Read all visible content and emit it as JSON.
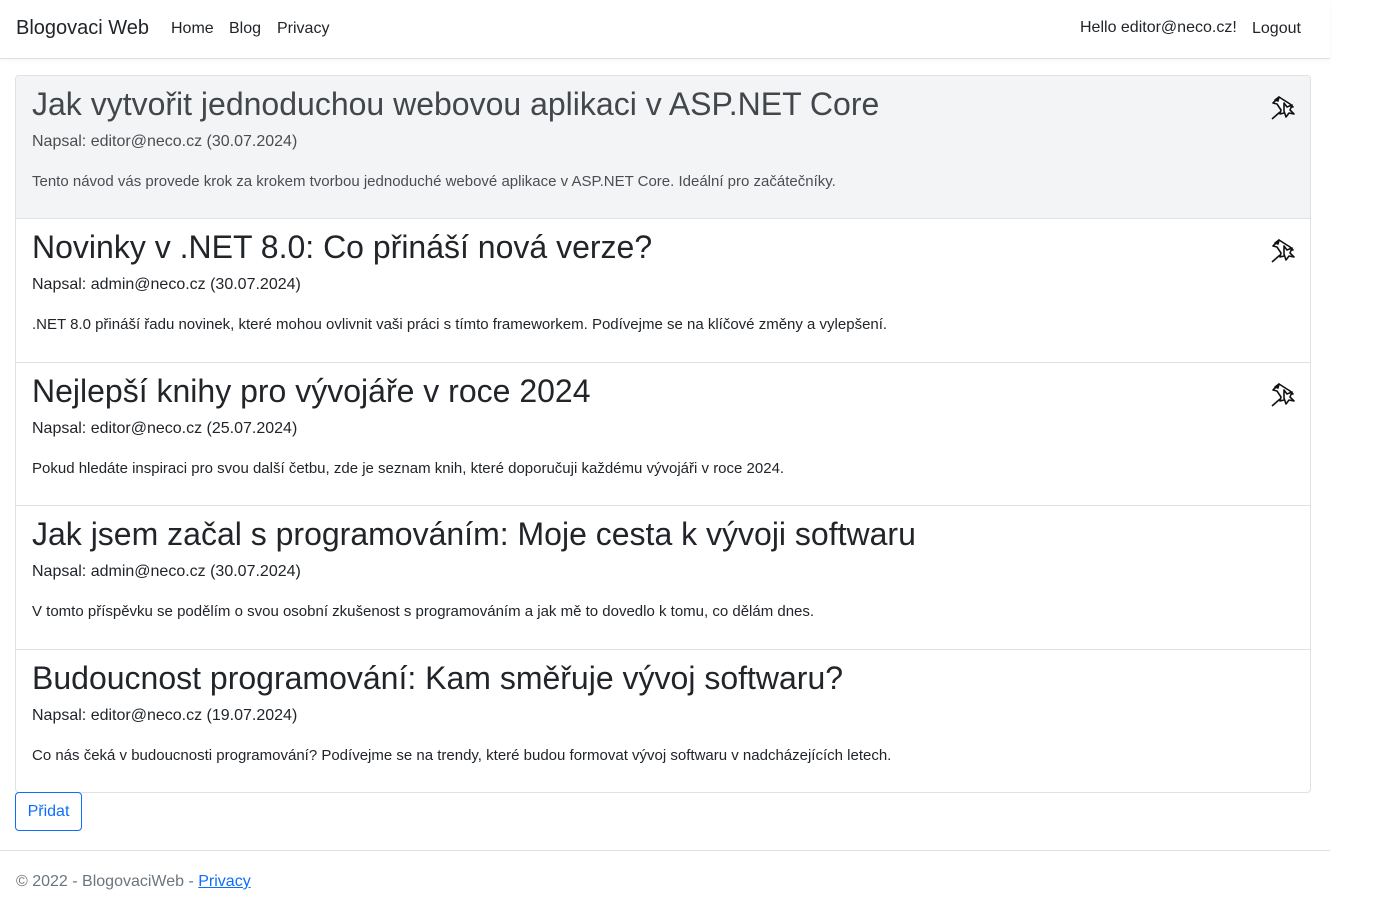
{
  "navbar": {
    "brand": "Blogovaci Web",
    "links": [
      "Home",
      "Blog",
      "Privacy"
    ],
    "greeting": "Hello editor@neco.cz!",
    "logout": "Logout"
  },
  "posts": [
    {
      "title": "Jak vytvořit jednoduchou webovou aplikaci v ASP.NET Core",
      "author": "Napsal: editor@neco.cz (30.07.2024)",
      "text": "Tento návod vás provede krok za krokem tvorbou jednoduché webové aplikace v ASP.NET Core. Ideální pro začátečníky.",
      "pinned": true,
      "active": true
    },
    {
      "title": "Novinky v .NET 8.0: Co přináší nová verze?",
      "author": "Napsal: admin@neco.cz (30.07.2024)",
      "text": ".NET 8.0 přináší řadu novinek, které mohou ovlivnit vaši práci s tímto frameworkem. Podívejme se na klíčové změny a vylepšení.",
      "pinned": true,
      "active": false
    },
    {
      "title": "Nejlepší knihy pro vývojáře v roce 2024",
      "author": "Napsal: editor@neco.cz (25.07.2024)",
      "text": "Pokud hledáte inspiraci pro svou další četbu, zde je seznam knih, které doporučuji každému vývojáři v roce 2024.",
      "pinned": true,
      "active": false
    },
    {
      "title": "Jak jsem začal s programováním: Moje cesta k vývoji softwaru",
      "author": "Napsal: admin@neco.cz (30.07.2024)",
      "text": "V tomto příspěvku se podělím o svou osobní zkušenost s programováním a jak mě to dovedlo k tomu, co dělám dnes.",
      "pinned": false,
      "active": false
    },
    {
      "title": "Budoucnost programování: Kam směřuje vývoj softwaru?",
      "author": "Napsal: editor@neco.cz (19.07.2024)",
      "text": "Co nás čeká v budoucnosti programování? Podívejme se na trendy, které budou formovat vývoj softwaru v nadcházejících letech.",
      "pinned": false,
      "active": false
    }
  ],
  "add_button": "Přidat",
  "footer": {
    "text": "© 2022 - BlogovaciWeb - ",
    "link": "Privacy"
  },
  "icons": {
    "pin": "pin-icon"
  },
  "colors": {
    "accent": "#0d6efd",
    "active_bg": "#f3f4f6",
    "border": "#dee2e6",
    "muted": "#6c757d"
  }
}
